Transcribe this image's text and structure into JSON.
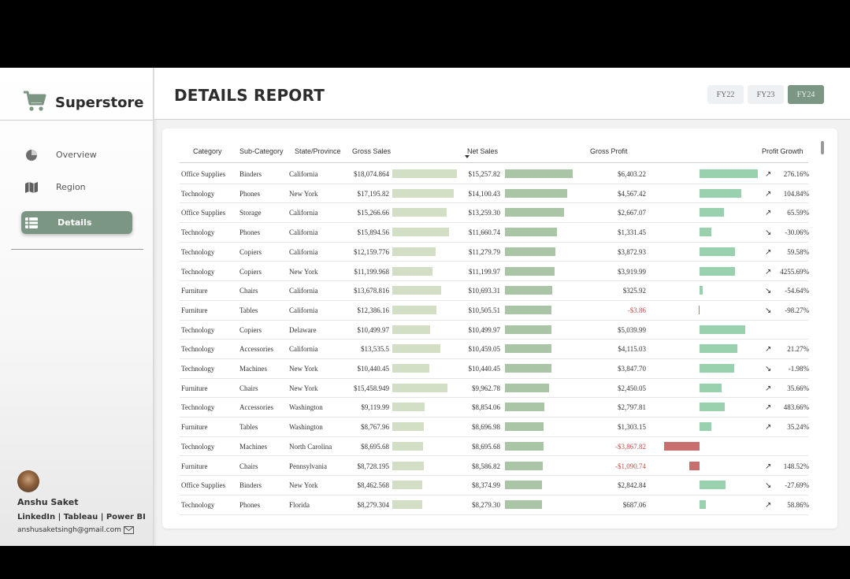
{
  "app": {
    "name": "Superstore",
    "page_title": "DETAILS REPORT"
  },
  "nav": {
    "items": [
      {
        "label": "Overview",
        "icon": "pie-chart-icon",
        "active": false
      },
      {
        "label": "Region",
        "icon": "map-icon",
        "active": false
      },
      {
        "label": "Details",
        "icon": "list-icon",
        "active": true
      }
    ]
  },
  "filters": {
    "years": [
      {
        "label": "FY22",
        "active": false
      },
      {
        "label": "FY23",
        "active": false
      },
      {
        "label": "FY24",
        "active": true
      }
    ]
  },
  "profile": {
    "name": "Anshu Saket",
    "links": "LinkedIn | Tableau | Power BI",
    "email": "anshusaketsingh@gmail.com"
  },
  "colors": {
    "accent": "#7c9684",
    "gross_bar": "#d3dfc4",
    "net_bar": "#a9c5a6",
    "profit_bar": "#99d0ae",
    "negative": "#c96e6e"
  },
  "table": {
    "columns": [
      "Category",
      "Sub-Category",
      "State/Province",
      "Gross Sales",
      "Net Sales",
      "Gross Profit",
      "Profit Growth"
    ],
    "sorted_column": "Net Sales",
    "rows": [
      {
        "category": "Office Supplies",
        "subcategory": "Binders",
        "state": "California",
        "gross_sales": "$18,074.864",
        "gross_value": 18074.86,
        "net_sales": "$15,257.82",
        "net_value": 15257.82,
        "gross_profit": "$6,403.22",
        "profit_value": 6403.22,
        "growth": "276.16%",
        "trend": "up"
      },
      {
        "category": "Technology",
        "subcategory": "Phones",
        "state": "New York",
        "gross_sales": "$17,195.82",
        "gross_value": 17195.82,
        "net_sales": "$14,100.43",
        "net_value": 14100.43,
        "gross_profit": "$4,567.42",
        "profit_value": 4567.42,
        "growth": "104.84%",
        "trend": "up"
      },
      {
        "category": "Office Supplies",
        "subcategory": "Storage",
        "state": "California",
        "gross_sales": "$15,266.66",
        "gross_value": 15266.66,
        "net_sales": "$13,259.30",
        "net_value": 13259.3,
        "gross_profit": "$2,667.07",
        "profit_value": 2667.07,
        "growth": "65.59%",
        "trend": "up"
      },
      {
        "category": "Technology",
        "subcategory": "Phones",
        "state": "California",
        "gross_sales": "$15,894.56",
        "gross_value": 15894.56,
        "net_sales": "$11,660.74",
        "net_value": 11660.74,
        "gross_profit": "$1,331.45",
        "profit_value": 1331.45,
        "growth": "-30.06%",
        "trend": "down"
      },
      {
        "category": "Technology",
        "subcategory": "Copiers",
        "state": "California",
        "gross_sales": "$12,159.776",
        "gross_value": 12159.78,
        "net_sales": "$11,279.79",
        "net_value": 11279.79,
        "gross_profit": "$3,872.93",
        "profit_value": 3872.93,
        "growth": "59.58%",
        "trend": "up"
      },
      {
        "category": "Technology",
        "subcategory": "Copiers",
        "state": "New York",
        "gross_sales": "$11,199.968",
        "gross_value": 11199.97,
        "net_sales": "$11,199.97",
        "net_value": 11199.97,
        "gross_profit": "$3,919.99",
        "profit_value": 3919.99,
        "growth": "4255.69%",
        "trend": "up"
      },
      {
        "category": "Furniture",
        "subcategory": "Chairs",
        "state": "California",
        "gross_sales": "$13,678.816",
        "gross_value": 13678.82,
        "net_sales": "$10,693.31",
        "net_value": 10693.31,
        "gross_profit": "$325.92",
        "profit_value": 325.92,
        "growth": "-54.64%",
        "trend": "down"
      },
      {
        "category": "Furniture",
        "subcategory": "Tables",
        "state": "California",
        "gross_sales": "$12,386.16",
        "gross_value": 12386.16,
        "net_sales": "$10,505.51",
        "net_value": 10505.51,
        "gross_profit": "-$3.86",
        "profit_value": -3.86,
        "growth": "-98.27%",
        "trend": "down"
      },
      {
        "category": "Technology",
        "subcategory": "Copiers",
        "state": "Delaware",
        "gross_sales": "$10,499.97",
        "gross_value": 10499.97,
        "net_sales": "$10,499.97",
        "net_value": 10499.97,
        "gross_profit": "$5,039.99",
        "profit_value": 5039.99,
        "growth": "",
        "trend": ""
      },
      {
        "category": "Technology",
        "subcategory": "Accessories",
        "state": "California",
        "gross_sales": "$13,535.5",
        "gross_value": 13535.5,
        "net_sales": "$10,459.05",
        "net_value": 10459.05,
        "gross_profit": "$4,115.03",
        "profit_value": 4115.03,
        "growth": "21.27%",
        "trend": "up"
      },
      {
        "category": "Technology",
        "subcategory": "Machines",
        "state": "New York",
        "gross_sales": "$10,440.45",
        "gross_value": 10440.45,
        "net_sales": "$10,440.45",
        "net_value": 10440.45,
        "gross_profit": "$3,847.70",
        "profit_value": 3847.7,
        "growth": "-1.98%",
        "trend": "down"
      },
      {
        "category": "Furniture",
        "subcategory": "Chairs",
        "state": "New York",
        "gross_sales": "$15,458.949",
        "gross_value": 15458.95,
        "net_sales": "$9,962.78",
        "net_value": 9962.78,
        "gross_profit": "$2,450.05",
        "profit_value": 2450.05,
        "growth": "35.66%",
        "trend": "up"
      },
      {
        "category": "Technology",
        "subcategory": "Accessories",
        "state": "Washington",
        "gross_sales": "$9,119.99",
        "gross_value": 9119.99,
        "net_sales": "$8,854.06",
        "net_value": 8854.06,
        "gross_profit": "$2,797.81",
        "profit_value": 2797.81,
        "growth": "483.66%",
        "trend": "up"
      },
      {
        "category": "Furniture",
        "subcategory": "Tables",
        "state": "Washington",
        "gross_sales": "$8,767.96",
        "gross_value": 8767.96,
        "net_sales": "$8,696.98",
        "net_value": 8696.98,
        "gross_profit": "$1,303.15",
        "profit_value": 1303.15,
        "growth": "35.24%",
        "trend": "up"
      },
      {
        "category": "Technology",
        "subcategory": "Machines",
        "state": "North Carolina",
        "gross_sales": "$8,695.68",
        "gross_value": 8695.68,
        "net_sales": "$8,695.68",
        "net_value": 8695.68,
        "gross_profit": "-$3,867.82",
        "profit_value": -3867.82,
        "growth": "",
        "trend": ""
      },
      {
        "category": "Furniture",
        "subcategory": "Chairs",
        "state": "Pennsylvania",
        "gross_sales": "$8,728.195",
        "gross_value": 8728.2,
        "net_sales": "$8,586.82",
        "net_value": 8586.82,
        "gross_profit": "-$1,090.74",
        "profit_value": -1090.74,
        "growth": "148.52%",
        "trend": "up"
      },
      {
        "category": "Office Supplies",
        "subcategory": "Binders",
        "state": "New York",
        "gross_sales": "$8,462.568",
        "gross_value": 8462.57,
        "net_sales": "$8,374.99",
        "net_value": 8374.99,
        "gross_profit": "$2,842.84",
        "profit_value": 2842.84,
        "growth": "-27.69%",
        "trend": "down"
      },
      {
        "category": "Technology",
        "subcategory": "Phones",
        "state": "Florida",
        "gross_sales": "$8,279.304",
        "gross_value": 8279.3,
        "net_sales": "$8,279.30",
        "net_value": 8279.3,
        "gross_profit": "$687.06",
        "profit_value": 687.06,
        "growth": "58.86%",
        "trend": "up"
      }
    ]
  }
}
